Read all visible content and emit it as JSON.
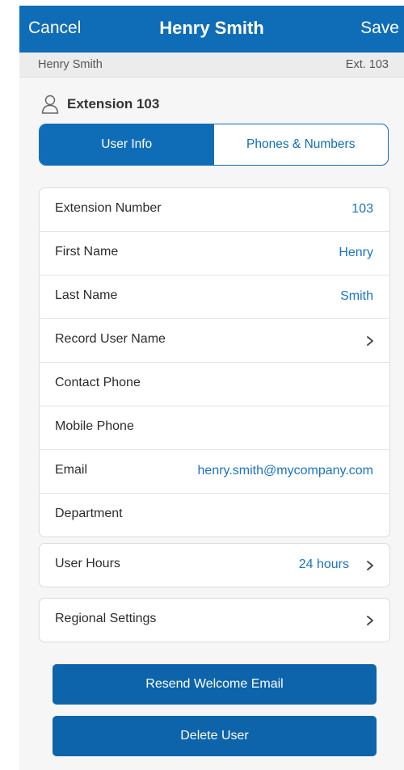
{
  "header": {
    "cancel_label": "Cancel",
    "title": "Henry Smith",
    "save_label": "Save"
  },
  "subheader": {
    "name": "Henry Smith",
    "extension": "Ext. 103"
  },
  "section": {
    "icon": "user-icon",
    "title": "Extension 103"
  },
  "tabs": [
    {
      "label": "User Info",
      "active": true
    },
    {
      "label": "Phones & Numbers",
      "active": false
    }
  ],
  "user_info_rows": [
    {
      "label": "Extension Number",
      "value": "103"
    },
    {
      "label": "First Name",
      "value": "Henry"
    },
    {
      "label": "Last Name",
      "value": "Smith"
    },
    {
      "label": "Record User Name",
      "value": ""
    },
    {
      "label": "Contact Phone",
      "value": ""
    },
    {
      "label": "Mobile Phone",
      "value": ""
    },
    {
      "label": "Email",
      "value": "henry.smith@mycompany.com"
    },
    {
      "label": "Department",
      "value": ""
    }
  ],
  "user_hours": {
    "label": "User Hours",
    "value": "24 hours"
  },
  "regional_settings": {
    "label": "Regional Settings"
  },
  "buttons": {
    "resend_label": "Resend Welcome Email",
    "delete_label": "Delete User"
  },
  "colors": {
    "primary": "#0f6db8",
    "link": "#1a73c4"
  }
}
